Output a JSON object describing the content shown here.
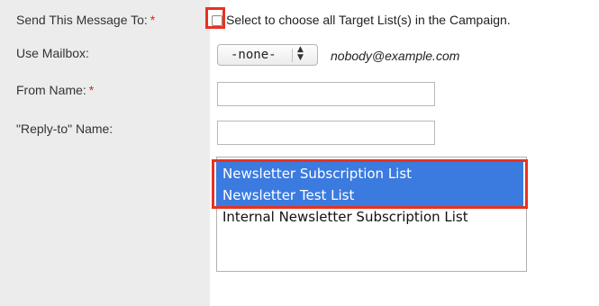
{
  "form": {
    "send_to": {
      "label": "Send This Message To:",
      "required_mark": "*",
      "checkbox_text": "Select to choose all Target List(s) in the Campaign.",
      "checked": false
    },
    "mailbox": {
      "label": "Use Mailbox:",
      "selected": "-none-",
      "email": "nobody@example.com"
    },
    "from_name": {
      "label": "From Name:",
      "required_mark": "*",
      "value": ""
    },
    "reply_to": {
      "label": "\"Reply-to\" Name:",
      "value": ""
    },
    "target_lists": {
      "options": [
        {
          "label": "Newsletter Subscription List",
          "selected": true
        },
        {
          "label": "Newsletter Test List",
          "selected": true
        },
        {
          "label": "Internal Newsletter Subscription List",
          "selected": false
        }
      ]
    }
  },
  "colors": {
    "label_column_bg": "#ececec",
    "required_mark": "#d9221c",
    "highlight_frame": "#e8321f",
    "selected_option_bg": "#3b7be0"
  }
}
